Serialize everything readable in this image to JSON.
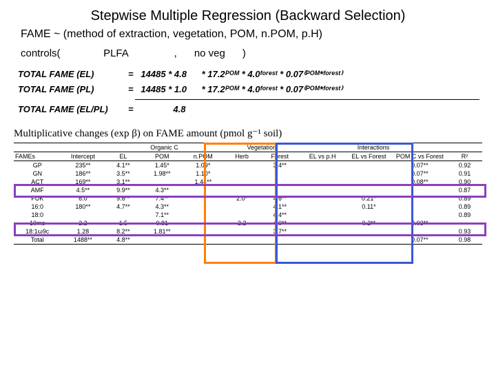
{
  "title": "Stepwise Multiple Regression (Backward Selection)",
  "subtitle": "FAME ~ (method of extraction, vegetation, POM, n.POM, p.H)",
  "controls_line": {
    "controls": "controls(",
    "plfa": "PLFA",
    "comma": ",",
    "noveg": "no veg",
    "close": ")"
  },
  "eq": {
    "row1_label": "TOTAL FAME (EL)",
    "row1_body": "=   14485 * 4.8      * 17.2ᴾᴼᴹ * 4.0ᶠᵒʳᵉˢᵗ * 0.07⁽ᴾᴼᴹ*ᶠᵒʳᵉˢᵗ⁾",
    "row2_label": "TOTAL FAME (PL)",
    "row2_body": "=   14485 * 1.0      * 17.2ᴾᴼᴹ * 4.0ᶠᵒʳᵉˢᵗ * 0.07⁽ᴾᴼᴹ*ᶠᵒʳᵉˢᵗ⁾",
    "row3_label": "TOTAL FAME (EL/PL)",
    "row3_body": "=                4.8"
  },
  "caption": "Multiplicative changes (exp β) on FAME amount (pmol g⁻¹ soil)",
  "table": {
    "groups": [
      "",
      "",
      "Organic C",
      "",
      "Vegetation",
      "",
      "Interactions",
      "",
      ""
    ],
    "group_spans": [
      1,
      1,
      3,
      0,
      2,
      0,
      3,
      0,
      1
    ],
    "headers": [
      "FAMEs",
      "Intercept",
      "EL",
      "POM",
      "n.POM",
      "Herb",
      "Forest",
      "EL vs p.H",
      "EL vs Forest",
      "POM C vs Forest",
      "R²"
    ],
    "rows": [
      [
        "GP",
        "235**",
        "4.1**",
        "1.45*",
        "1.09*",
        "",
        "3.4**",
        "",
        "",
        "0.07**",
        "0.92"
      ],
      [
        "GN",
        "186**",
        "3.5**",
        "1.98**",
        "1.10*",
        "",
        "",
        "",
        "",
        "0.07**",
        "0.91"
      ],
      [
        "ACT",
        "169**",
        "3.1**",
        "",
        "1.44**",
        "",
        "",
        "",
        "",
        "0.08**",
        "0.90"
      ],
      [
        "AMF",
        "4.5**",
        "9.9**",
        "4.3**",
        "",
        "",
        "",
        "",
        "",
        "",
        "0.87"
      ],
      [
        "FUK",
        "6.0",
        "9.6**",
        "7.4**",
        "",
        "2.0*",
        "4.6**",
        "",
        "0.21*",
        "",
        "0.89"
      ],
      [
        "16:0",
        "180**",
        "4.7**",
        "4.3**",
        "",
        "",
        "4.1**",
        "",
        "0.11*",
        "",
        "0.89"
      ],
      [
        "18:0",
        "",
        "",
        "7.1**",
        "",
        "",
        "4.4**",
        "",
        "",
        "",
        "0.89"
      ],
      [
        "10me",
        "2.2",
        "1.5",
        "0.81",
        "",
        "2.2",
        "4.0**",
        "",
        "0.2**",
        "0.03**",
        "-"
      ],
      [
        "18:1ω9c",
        "1.28",
        "8.2**",
        "1.81**",
        "",
        "",
        "3.7**",
        "",
        "",
        "",
        "0.93"
      ],
      [
        "Total",
        "1488**",
        "4.8**",
        "",
        "",
        "",
        "",
        "",
        "",
        "0.07**",
        "0.98"
      ]
    ]
  }
}
